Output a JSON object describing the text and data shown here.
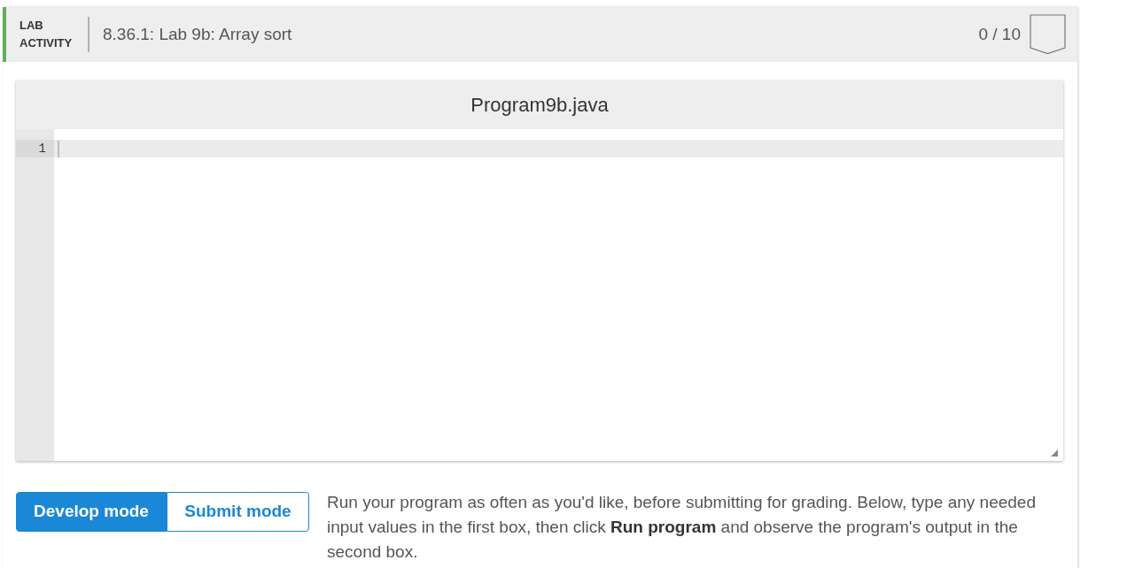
{
  "header": {
    "label": "LAB ACTIVITY",
    "title": "8.36.1: Lab 9b: Array sort",
    "score": "0 / 10",
    "completed": false
  },
  "editor": {
    "filename": "Program9b.java",
    "lines": [
      {
        "number": "1",
        "active": true
      }
    ]
  },
  "modes": [
    {
      "label": "Develop mode",
      "selected": true
    },
    {
      "label": "Submit mode",
      "selected": false
    }
  ],
  "instructions": "Run your program as often as you'd like, before submitting for grading. Below, type any needed input values in the first box, then click **Run program** and observe the program's output in the second box."
}
